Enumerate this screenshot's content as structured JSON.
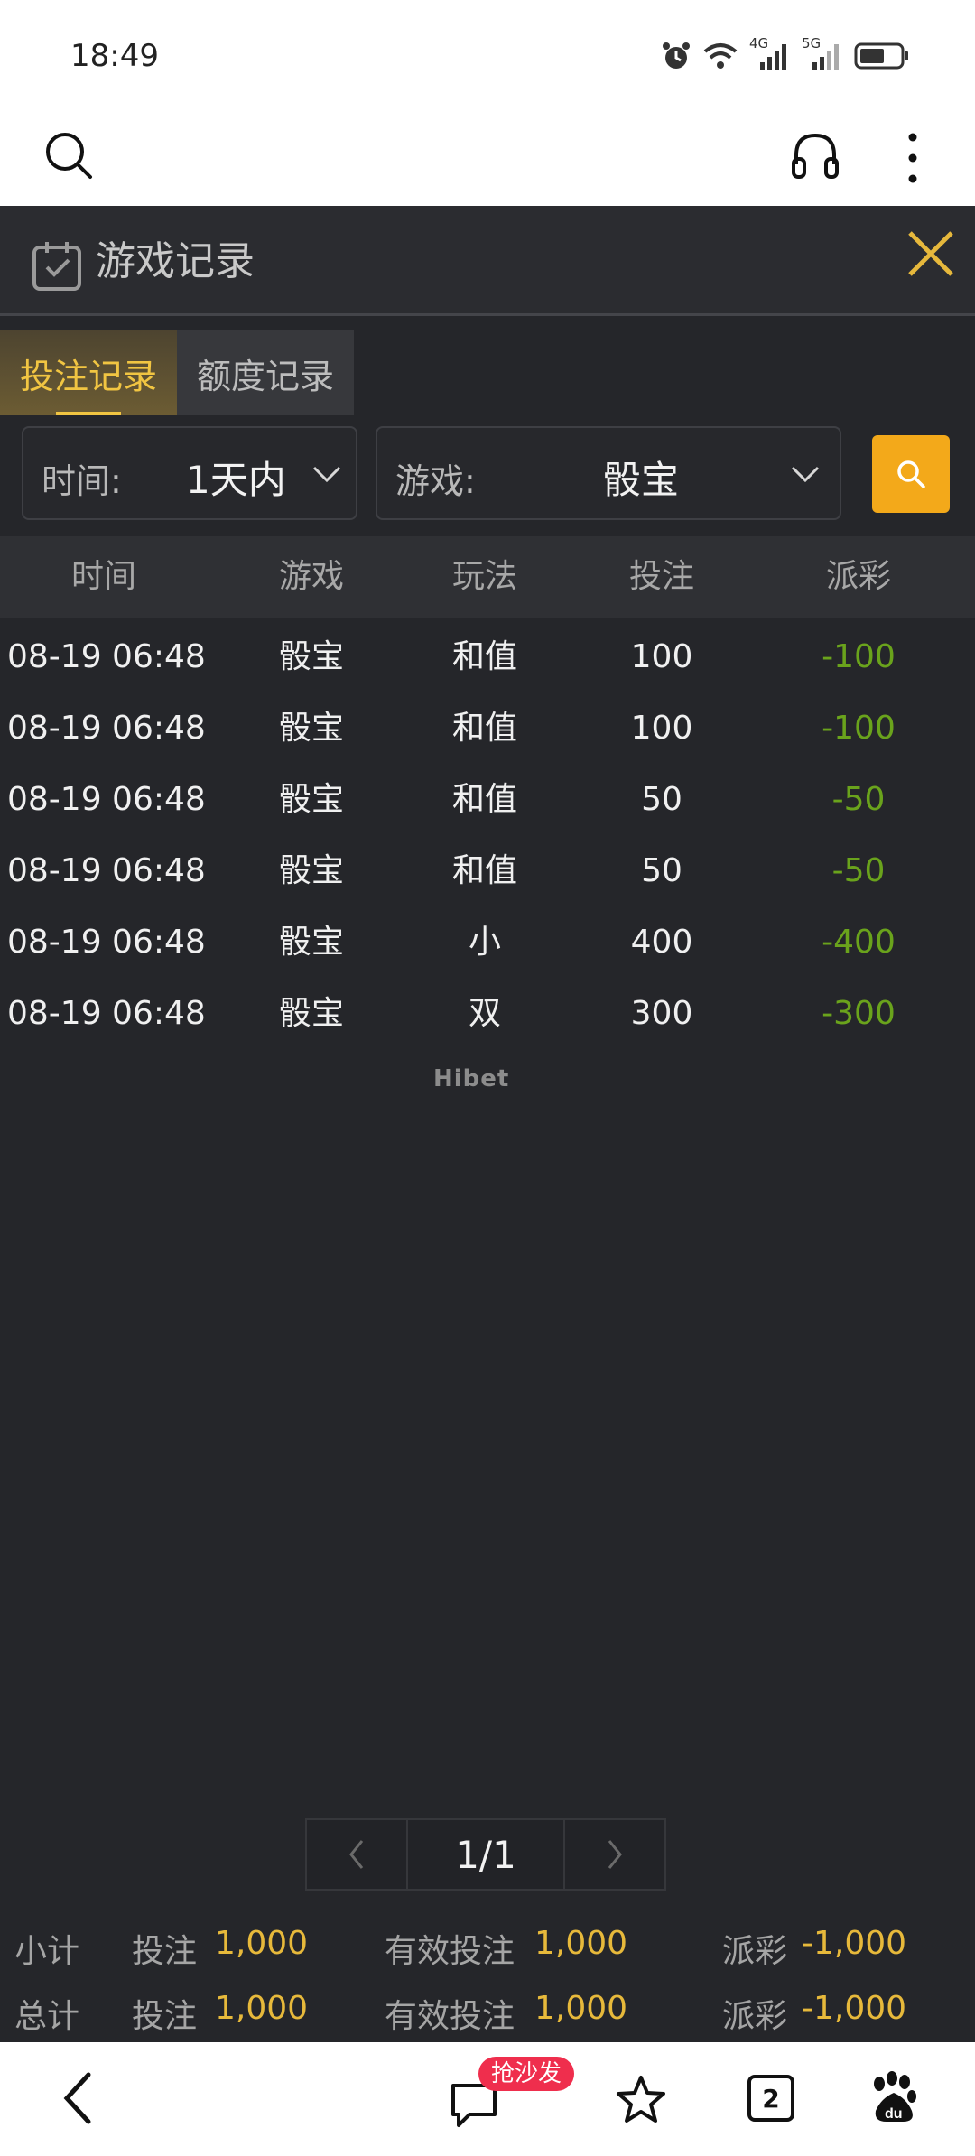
{
  "status_bar": {
    "time": "18:49",
    "net_left": "4G",
    "net_right": "5G"
  },
  "browser": {
    "icons": [
      "search-icon",
      "headset-icon",
      "more-vertical-icon"
    ]
  },
  "app": {
    "title": "游戏记录",
    "tabs": [
      {
        "label": "投注记录",
        "active": true
      },
      {
        "label": "额度记录",
        "active": false
      }
    ],
    "filters": {
      "time_label": "时间:",
      "time_value": "1天内",
      "game_label": "游戏:",
      "game_value": "骰宝"
    },
    "columns": [
      "时间",
      "游戏",
      "玩法",
      "投注",
      "派彩"
    ],
    "rows": [
      {
        "time": "08-19 06:48",
        "game": "骰宝",
        "play": "和值",
        "bet": "100",
        "payout": "-100"
      },
      {
        "time": "08-19 06:48",
        "game": "骰宝",
        "play": "和值",
        "bet": "100",
        "payout": "-100"
      },
      {
        "time": "08-19 06:48",
        "game": "骰宝",
        "play": "和值",
        "bet": "50",
        "payout": "-50"
      },
      {
        "time": "08-19 06:48",
        "game": "骰宝",
        "play": "和值",
        "bet": "50",
        "payout": "-50"
      },
      {
        "time": "08-19 06:48",
        "game": "骰宝",
        "play": "小",
        "bet": "400",
        "payout": "-400"
      },
      {
        "time": "08-19 06:48",
        "game": "骰宝",
        "play": "双",
        "bet": "300",
        "payout": "-300"
      }
    ],
    "watermark": "Hibet",
    "pager": {
      "page": "1/1"
    },
    "subtotal": {
      "label": "小计",
      "bet_label": "投注",
      "bet_value": "1,000",
      "valid_label": "有效投注",
      "valid_value": "1,000",
      "payout_label": "派彩",
      "payout_value": "-1,000"
    },
    "total": {
      "label": "总计",
      "bet_label": "投注",
      "bet_value": "1,000",
      "valid_label": "有效投注",
      "valid_value": "1,000",
      "payout_label": "派彩",
      "payout_value": "-1,000"
    }
  },
  "bottom_nav": {
    "badge": "抢沙发",
    "tab_count": "2",
    "icons": [
      "back-icon",
      "comment-icon",
      "star-icon",
      "tabs-icon",
      "baidu-icon"
    ]
  },
  "colors": {
    "accent_gold": "#f1c542",
    "search_orange": "#f3a91a",
    "payout_green": "#6aa31c",
    "badge_red": "#ef2e4d"
  }
}
